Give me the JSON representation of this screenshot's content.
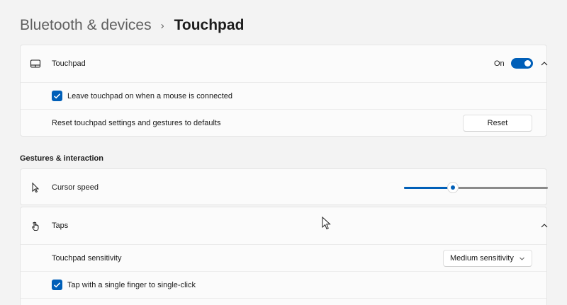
{
  "breadcrumb": {
    "parent": "Bluetooth & devices",
    "separator": "›",
    "current": "Touchpad"
  },
  "touchpad_card": {
    "header": {
      "icon": "touchpad-icon",
      "label": "Touchpad",
      "toggle_state": "On",
      "toggle_on": true,
      "expanded": true
    },
    "leave_on": {
      "checked": true,
      "label": "Leave touchpad on when a mouse is connected"
    },
    "reset_row": {
      "label": "Reset touchpad settings and gestures to defaults",
      "button_label": "Reset"
    }
  },
  "gestures_section": {
    "heading": "Gestures & interaction",
    "cursor_speed": {
      "icon": "cursor-icon",
      "label": "Cursor speed",
      "value_fraction": 0.34
    },
    "taps": {
      "icon": "tap-hand-icon",
      "label": "Taps",
      "expanded": true,
      "sensitivity": {
        "label": "Touchpad sensitivity",
        "selected": "Medium sensitivity"
      },
      "single_tap": {
        "checked": true,
        "label": "Tap with a single finger to single-click"
      }
    }
  },
  "colors": {
    "accent": "#005fb8",
    "background": "#f3f3f3",
    "card": "#fbfbfb"
  }
}
